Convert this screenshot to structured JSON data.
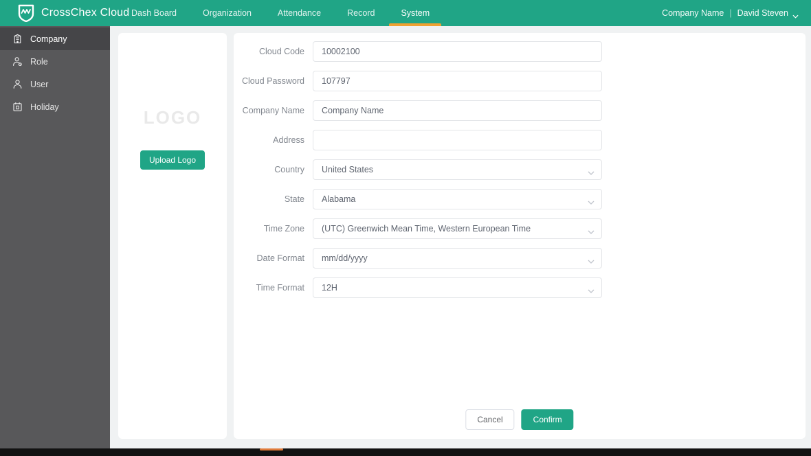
{
  "topbar": {
    "brand": "CrossChex Cloud",
    "nav": [
      {
        "label": "Dash Board"
      },
      {
        "label": "Organization"
      },
      {
        "label": "Attendance"
      },
      {
        "label": "Record"
      },
      {
        "label": "System"
      }
    ],
    "company": "Company Name",
    "separator": "|",
    "user": "David Steven"
  },
  "sidebar": {
    "items": [
      {
        "label": "Company",
        "icon": "building-icon"
      },
      {
        "label": "Role",
        "icon": "role-icon"
      },
      {
        "label": "User",
        "icon": "user-icon"
      },
      {
        "label": "Holiday",
        "icon": "calendar-icon"
      }
    ]
  },
  "logo_panel": {
    "placeholder": "LOGO",
    "upload_label": "Upload Logo"
  },
  "form": {
    "fields": [
      {
        "label": "Cloud Code",
        "value": "10002100",
        "type": "input"
      },
      {
        "label": "Cloud Password",
        "value": "107797",
        "type": "input"
      },
      {
        "label": "Company Name",
        "value": "Company Name",
        "type": "input"
      },
      {
        "label": "Address",
        "value": "",
        "type": "input"
      },
      {
        "label": "Country",
        "value": "United States",
        "type": "select"
      },
      {
        "label": "State",
        "value": "Alabama",
        "type": "select"
      },
      {
        "label": "Time Zone",
        "value": "(UTC) Greenwich Mean Time, Western European Time",
        "type": "select"
      },
      {
        "label": "Date Format",
        "value": "mm/dd/yyyy",
        "type": "select"
      },
      {
        "label": "Time Format",
        "value": "12H",
        "type": "select"
      }
    ],
    "cancel_label": "Cancel",
    "confirm_label": "Confirm"
  },
  "colors": {
    "accent_green": "#20a586",
    "accent_orange": "#efa131",
    "sidebar_bg": "#58585a",
    "sidebar_active_bg": "#454548",
    "bottom_bar": "#121212"
  }
}
